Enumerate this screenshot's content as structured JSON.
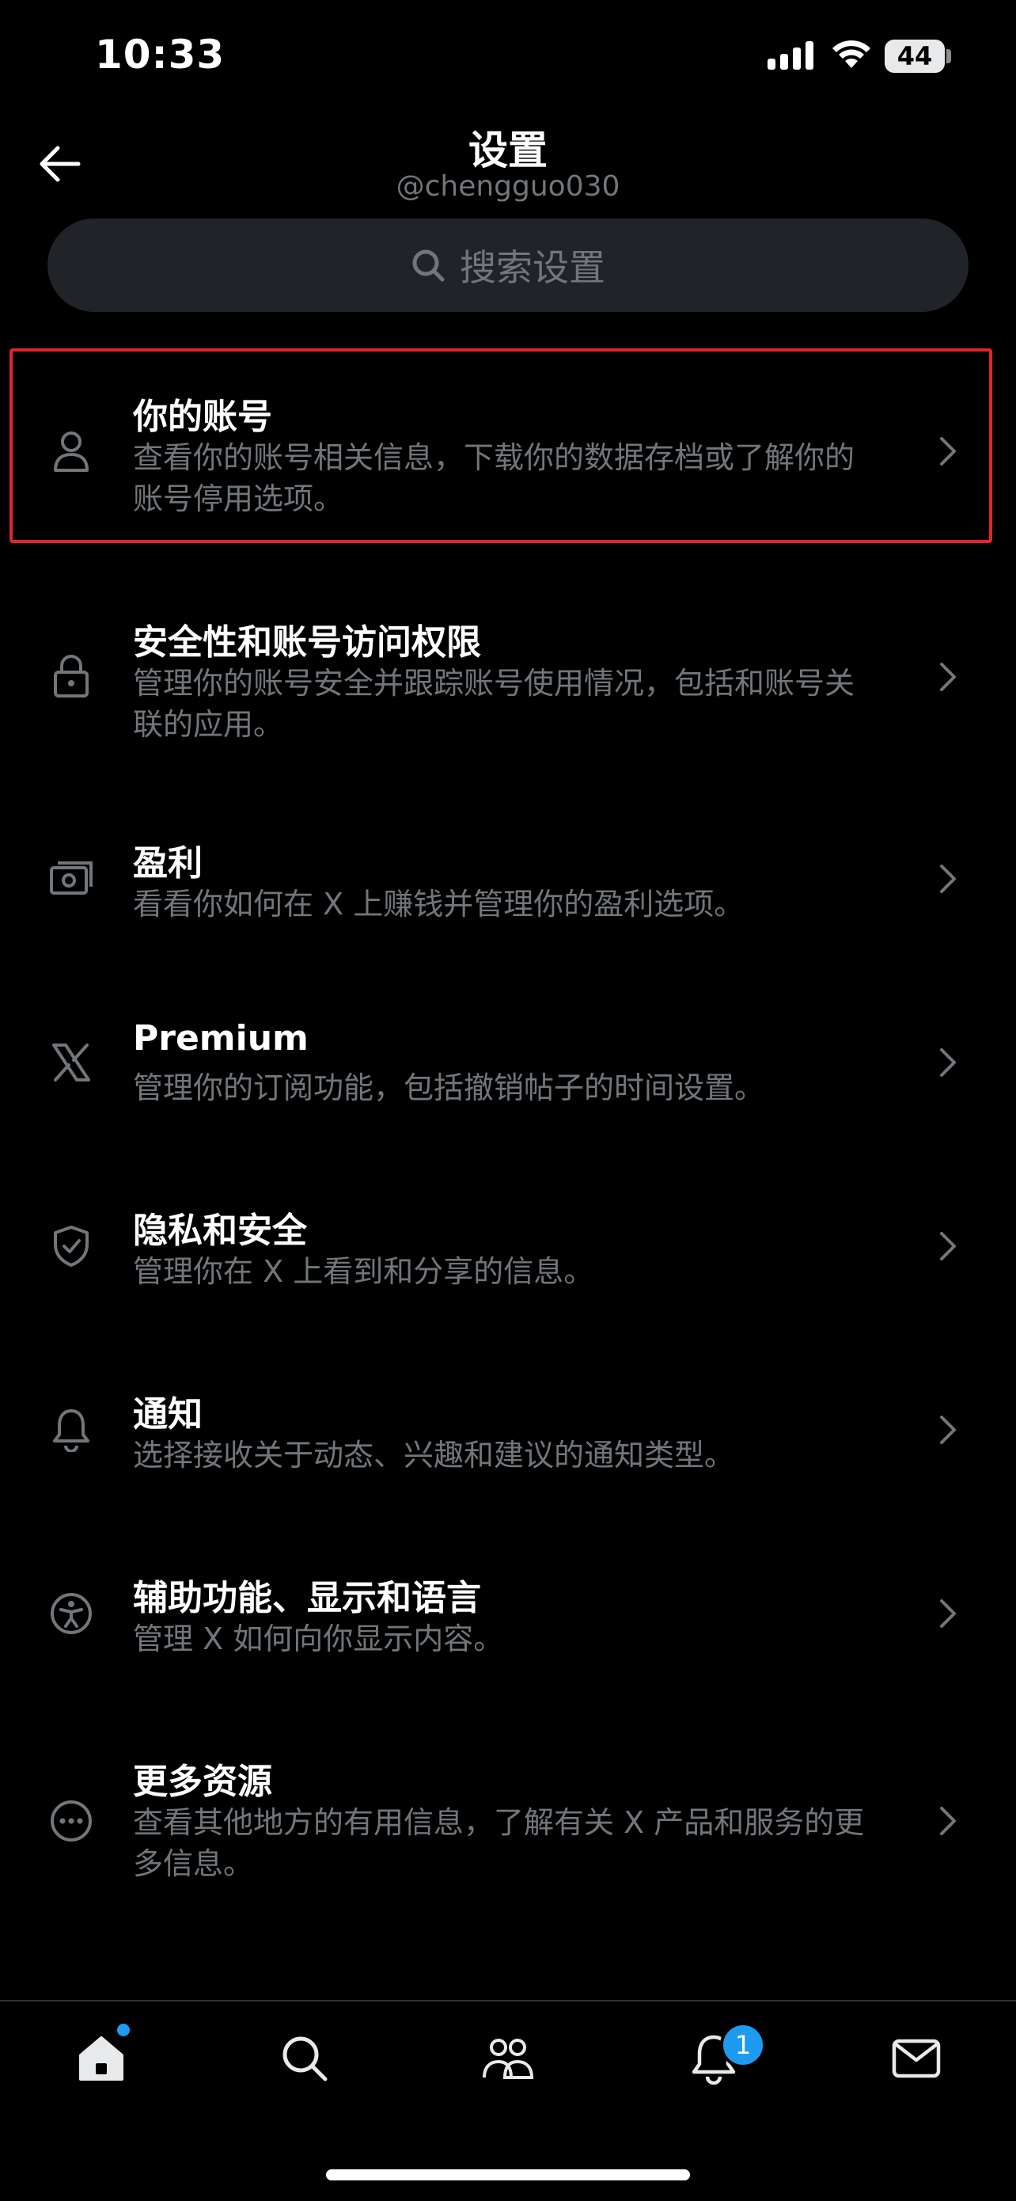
{
  "status_bar": {
    "time": "10:33",
    "battery": "44"
  },
  "header": {
    "title": "设置",
    "subtitle": "@chengguo030"
  },
  "search": {
    "placeholder": "搜索设置"
  },
  "settings": [
    {
      "title": "你的账号",
      "description": "查看你的账号相关信息，下载你的数据存档或了解你的账号停用选项。",
      "icon": "person-icon"
    },
    {
      "title": "安全性和账号访问权限",
      "description": "管理你的账号安全并跟踪账号使用情况，包括和账号关联的应用。",
      "icon": "lock-icon"
    },
    {
      "title": "盈利",
      "description": "看看你如何在 X 上赚钱并管理你的盈利选项。",
      "icon": "money-icon"
    },
    {
      "title": "Premium",
      "description": "管理你的订阅功能，包括撤销帖子的时间设置。",
      "icon": "x-logo-icon"
    },
    {
      "title": "隐私和安全",
      "description": "管理你在 X 上看到和分享的信息。",
      "icon": "shield-icon"
    },
    {
      "title": "通知",
      "description": "选择接收关于动态、兴趣和建议的通知类型。",
      "icon": "bell-icon"
    },
    {
      "title": "辅助功能、显示和语言",
      "description": "管理 X 如何向你显示内容。",
      "icon": "accessibility-icon"
    },
    {
      "title": "更多资源",
      "description": "查看其他地方的有用信息，了解有关 X 产品和服务的更多信息。",
      "icon": "more-icon"
    }
  ],
  "tab_bar": {
    "tabs": [
      "home-icon",
      "search-icon",
      "communities-icon",
      "notifications-icon",
      "messages-icon"
    ],
    "notifications_badge": "1"
  },
  "colors": {
    "accent": "#1d9bf0",
    "highlight": "#e0242b",
    "muted": "#71767b"
  }
}
